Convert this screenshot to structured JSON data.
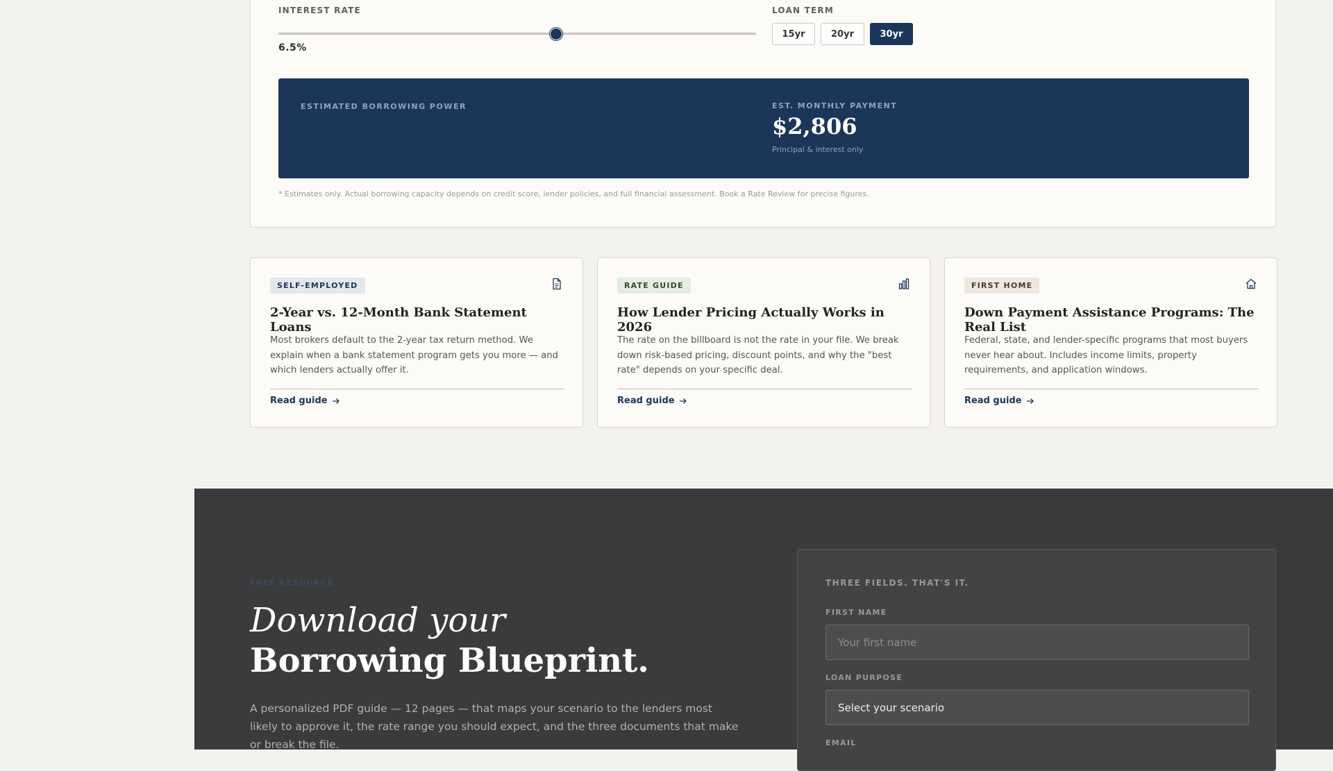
{
  "calculator": {
    "interest_rate_label": "INTEREST RATE",
    "interest_rate_value": "6.5%",
    "interest_rate_fraction": 0.58,
    "loan_term_label": "LOAN TERM",
    "loan_terms": [
      "15yr",
      "20yr",
      "30yr"
    ],
    "selected_term": "30yr",
    "borrowing_power_label": "ESTIMATED BORROWING POWER",
    "monthly_payment_label": "EST. MONTHLY PAYMENT",
    "monthly_payment_value": "$2,806",
    "monthly_payment_note": "Principal & interest only",
    "disclaimer": "* Estimates only. Actual borrowing capacity depends on credit score, lender policies, and full financial assessment. Book a Rate Review for precise figures."
  },
  "guides": [
    {
      "tag": "SELF-EMPLOYED",
      "tag_bg": "#e3e8ef",
      "tag_color": "#1b3658",
      "icon": "document-icon",
      "title": "2-Year vs. 12-Month Bank Statement Loans",
      "body": "Most brokers default to the 2-year tax return method. We explain when a bank statement program gets you more — and which lenders actually offer it.",
      "link": "Read guide"
    },
    {
      "tag": "RATE GUIDE",
      "tag_bg": "#e6ede3",
      "tag_color": "#2f4a2a",
      "icon": "bar-chart-icon",
      "title": "How Lender Pricing Actually Works in 2026",
      "body": "The rate on the billboard is not the rate in your file. We break down risk-based pricing, discount points, and why the \"best rate\" depends on your specific deal.",
      "link": "Read guide"
    },
    {
      "tag": "FIRST HOME",
      "tag_bg": "#efe8e0",
      "tag_color": "#4a3a2a",
      "icon": "home-icon",
      "title": "Down Payment Assistance Programs: The Real List",
      "body": "Federal, state, and lender-specific programs that most buyers never hear about. Includes income limits, property requirements, and application windows.",
      "link": "Read guide"
    }
  ],
  "blueprint": {
    "eyebrow": "FREE RESOURCE",
    "headline_line1": "Download your",
    "headline_line2": "Borrowing Blueprint.",
    "body": "A personalized PDF guide — 12 pages — that maps your scenario to the lenders most likely to approve it, the rate range you should expect, and the three documents that make or break the file.",
    "form": {
      "heading": "THREE FIELDS. THAT'S IT.",
      "first_name_label": "FIRST NAME",
      "first_name_placeholder": "Your first name",
      "loan_purpose_label": "LOAN PURPOSE",
      "loan_purpose_value": "Select your scenario",
      "email_label": "EMAIL"
    }
  },
  "colors": {
    "navy": "#1b3658",
    "page_bg": "#f4f2ee",
    "dark_section": "#3b3b3d"
  }
}
